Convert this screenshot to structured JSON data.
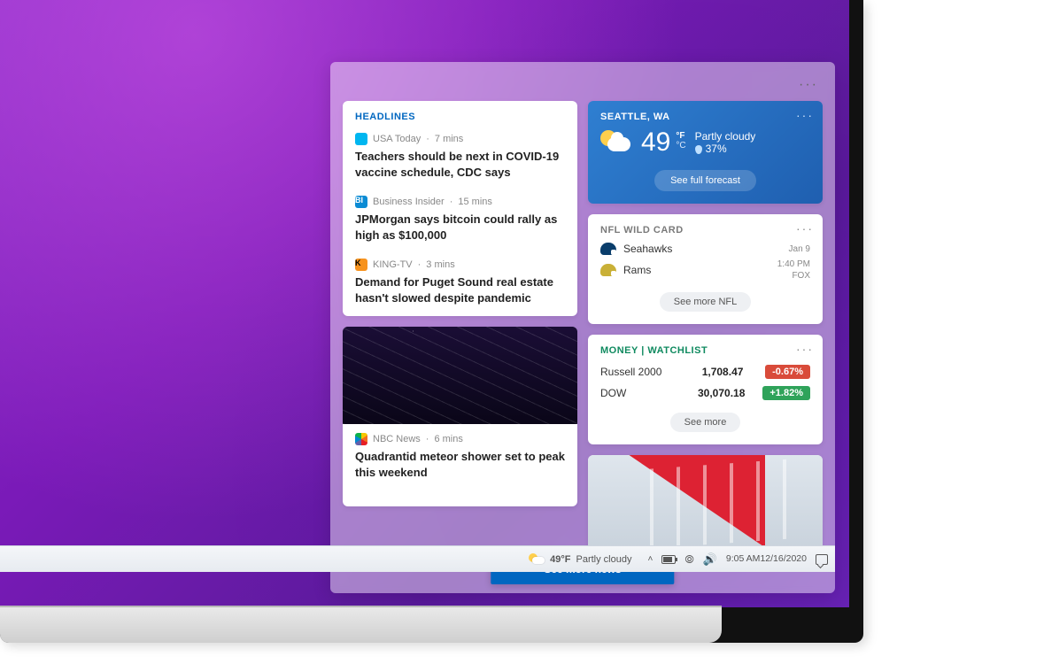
{
  "panel": {
    "headlines": {
      "title": "HEADLINES",
      "items": [
        {
          "publisher": "USA Today",
          "age": "7 mins",
          "title": "Teachers should be next in COVID-19 vaccine schedule, CDC says",
          "pubIcon": "USA"
        },
        {
          "publisher": "Business Insider",
          "age": "15 mins",
          "title": "JPMorgan says bitcoin could rally as high as $100,000",
          "pubIcon": "BI"
        },
        {
          "publisher": "KING-TV",
          "age": "3 mins",
          "title": "Demand for Puget Sound real estate hasn't slowed despite pandemic",
          "pubIcon": "K"
        }
      ]
    },
    "photoStory": {
      "publisher": "NBC News",
      "age": "6 mins",
      "title": "Quadrantid meteor shower set to peak this weekend"
    },
    "seeMoreNews": "See more news",
    "weather": {
      "location": "SEATTLE, WA",
      "temp": "49",
      "unit_f": "°F",
      "unit_c": "°C",
      "condition": "Partly cloudy",
      "precip": "37%",
      "forecastBtn": "See full forecast"
    },
    "sports": {
      "title": "NFL WILD CARD",
      "team1": "Seahawks",
      "team2": "Rams",
      "date": "Jan 9",
      "time": "1:40 PM",
      "channel": "FOX",
      "moreBtn": "See more NFL"
    },
    "money": {
      "title": "MONEY | WATCHLIST",
      "rows": [
        {
          "name": "Russell 2000",
          "value": "1,708.47",
          "change": "-0.67%",
          "dir": "neg"
        },
        {
          "name": "DOW",
          "value": "30,070.18",
          "change": "+1.82%",
          "dir": "pos"
        }
      ],
      "moreBtn": "See more"
    }
  },
  "taskbar": {
    "temp": "49°F",
    "condition": "Partly cloudy",
    "time": "9:05 AM",
    "date": "12/16/2020"
  }
}
